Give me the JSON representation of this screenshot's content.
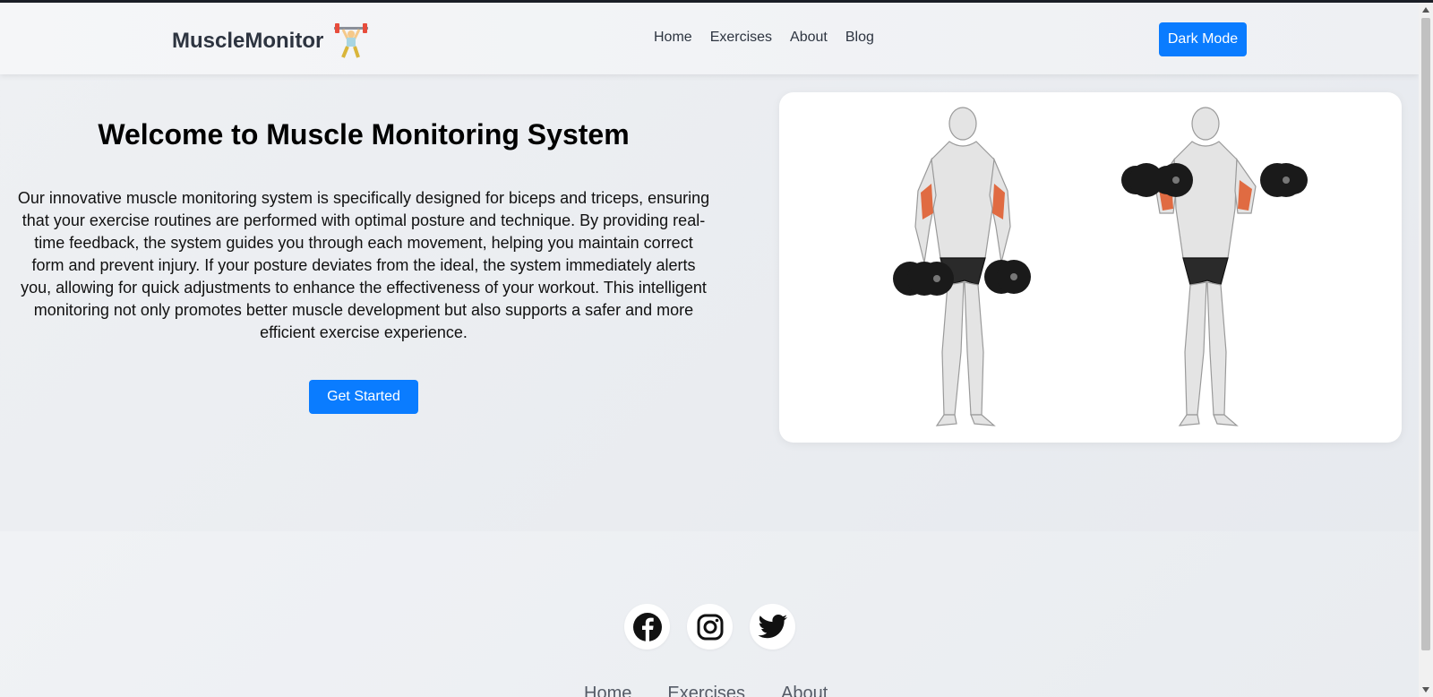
{
  "navbar": {
    "brand": "MuscleMonitor",
    "brand_icon": "weightlifter-icon",
    "links": [
      "Home",
      "Exercises",
      "About",
      "Blog"
    ],
    "dark_mode_label": "Dark Mode"
  },
  "hero": {
    "title": "Welcome to Muscle Monitoring System",
    "description": "Our innovative muscle monitoring system is specifically designed for biceps and triceps, ensuring that your exercise routines are performed with optimal posture and technique. By providing real-time feedback, the system guides you through each movement, helping you maintain correct form and prevent injury. If your posture deviates from the ideal, the system immediately alerts you, allowing for quick adjustments to enhance the effectiveness of your workout. This intelligent monitoring not only promotes better muscle development but also supports a safer and more efficient exercise experience.",
    "cta_label": "Get Started"
  },
  "footer": {
    "socials": [
      "facebook-icon",
      "instagram-icon",
      "twitter-icon"
    ],
    "links": [
      "Home",
      "Exercises",
      "About"
    ]
  },
  "colors": {
    "accent": "#0a7cff",
    "muscle_highlight": "#e06b42"
  }
}
